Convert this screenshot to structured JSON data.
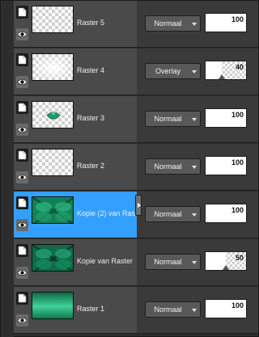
{
  "layers": [
    {
      "name": "Raster 5",
      "blend_mode": "Normaal",
      "opacity": 100,
      "thumbnail": "transparent",
      "selected": false
    },
    {
      "name": "Raster 4",
      "blend_mode": "Overlay",
      "opacity": 40,
      "thumbnail": "white-glow",
      "selected": false
    },
    {
      "name": "Raster 3",
      "blend_mode": "Normaal",
      "opacity": 100,
      "thumbnail": "green-gem",
      "selected": false
    },
    {
      "name": "Raster 2",
      "blend_mode": "Normaal",
      "opacity": 100,
      "thumbnail": "transparent",
      "selected": false
    },
    {
      "name": "Kopie (2) van Ras",
      "blend_mode": "Normaal",
      "opacity": 100,
      "thumbnail": "green-flower",
      "selected": true
    },
    {
      "name": "Kopie van Raster",
      "blend_mode": "Normaal",
      "opacity": 50,
      "thumbnail": "green-flower-dark",
      "selected": false
    },
    {
      "name": "Raster 1",
      "blend_mode": "Normaal",
      "opacity": 100,
      "thumbnail": "green-gradient",
      "selected": false
    }
  ],
  "icons": {
    "layer_type": "raster-layer-icon",
    "visibility": "eye-icon",
    "dropdown": "chevron-down-icon",
    "collapse": "chevron-right-icon"
  },
  "colors": {
    "selected_row": "#33a0ff",
    "accent_green": "#1f9a6a"
  }
}
